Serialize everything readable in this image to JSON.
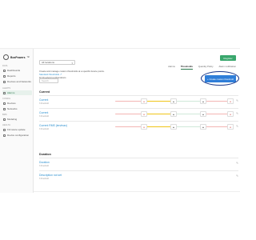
{
  "brand": {
    "name": "BoxPowers",
    "name_tm": "™"
  },
  "sidebar": {
    "sections": [
      {
        "label": "DATA",
        "items": [
          {
            "label": "Dashboards",
            "active": false
          },
          {
            "label": "Reports",
            "active": false
          },
          {
            "label": "Devices and Networks",
            "active": false
          }
        ]
      },
      {
        "label": "ALERTS",
        "items": [
          {
            "label": "Alarms",
            "active": true
          }
        ]
      },
      {
        "label": "CONFIG",
        "items": [
          {
            "label": "Devices",
            "active": false
          },
          {
            "label": "Networks",
            "active": false
          }
        ]
      },
      {
        "label": "BMS",
        "items": [
          {
            "label": "Modeling",
            "active": false
          }
        ]
      },
      {
        "label": "HEALTH",
        "items": [
          {
            "label": "Firmware update",
            "active": false
          },
          {
            "label": "Device configuration",
            "active": false
          }
        ]
      }
    ]
  },
  "topbar": {
    "select_value": "All locations",
    "user_label": "Register"
  },
  "tabs": [
    {
      "label": "Alarms",
      "active": false
    },
    {
      "label": "Thresholds",
      "active": true
    },
    {
      "label": "Quantity Policy",
      "active": false
    },
    {
      "label": "Alarm notification",
      "active": false
    }
  ],
  "intro": {
    "text": "Create and manage custom thresholds at a specific device points.",
    "link": "Standard thresholds ↗",
    "count": "10 threshold configurations"
  },
  "search_placeholder": "Search",
  "create_button": "+ Create custom threshold",
  "groups": [
    {
      "title": "Current",
      "items": [
        {
          "name": "Current",
          "sub": "3 threshold",
          "thresholds": [
            "High",
            "High",
            "Low",
            "Low"
          ]
        },
        {
          "name": "Current",
          "sub": "3 threshold",
          "thresholds": [
            "High",
            "High",
            "Low",
            "Low"
          ]
        },
        {
          "name": "Current RMS (ten/max)",
          "sub": "3 threshold",
          "thresholds": [
            "High",
            "High",
            "Low",
            "Low"
          ]
        }
      ]
    },
    {
      "title": "Duration",
      "items": [
        {
          "name": "Duration",
          "sub": "3 threshold",
          "thresholds": []
        },
        {
          "name": "Description not set",
          "sub": "3 threshold",
          "thresholds": []
        }
      ]
    }
  ],
  "colors": {
    "accent": "#3aa76d",
    "link": "#2b8fcf",
    "primary_button": "#2f7ed8",
    "highlight_ring": "#1e3a8a",
    "alarm": "#d9534f",
    "warn": "#f0c419"
  }
}
